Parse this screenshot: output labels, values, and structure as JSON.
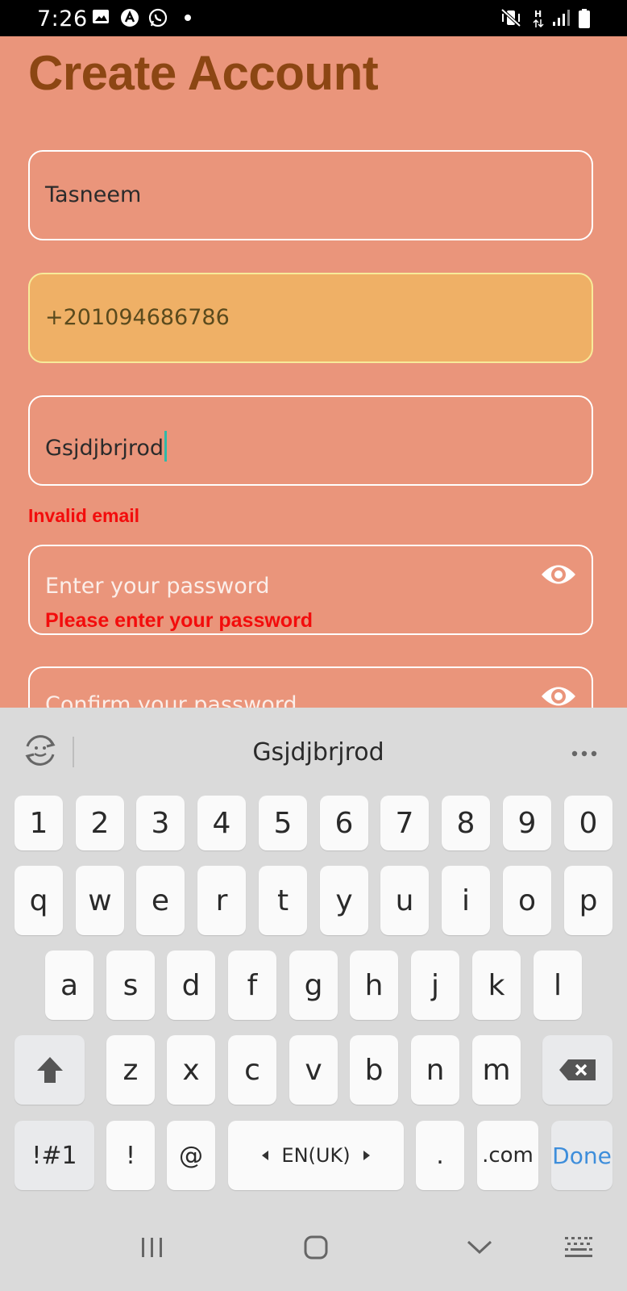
{
  "status_bar": {
    "time": "7:26",
    "icons_left": [
      "gallery-icon",
      "assistant-icon",
      "whatsapp-icon",
      "notification-dot"
    ],
    "icons_right": [
      "vibrate-mute-icon",
      "network-h-icon",
      "signal-icon",
      "battery-icon"
    ]
  },
  "page": {
    "title": "Create Account",
    "title_color": "#8C4613",
    "background": "#EA957B"
  },
  "form": {
    "name_value": "Tasneem",
    "phone_value": "+201094686786",
    "email_value": "Gsjdjbrjrod",
    "email_error": "Invalid email",
    "password_placeholder": "Enter your password",
    "password_error": "Please enter your password",
    "confirm_placeholder": "Confirm your password",
    "error_color": "#F30C0C"
  },
  "keyboard": {
    "suggestion": "Gsjdjbrjrod",
    "rows": [
      [
        "1",
        "2",
        "3",
        "4",
        "5",
        "6",
        "7",
        "8",
        "9",
        "0"
      ],
      [
        "q",
        "w",
        "e",
        "r",
        "t",
        "y",
        "u",
        "i",
        "o",
        "p"
      ],
      [
        "a",
        "s",
        "d",
        "f",
        "g",
        "h",
        "j",
        "k",
        "l"
      ],
      [
        "z",
        "x",
        "c",
        "v",
        "b",
        "n",
        "m"
      ]
    ],
    "symbols_label": "!#1",
    "exclaim_label": "!",
    "at_label": "@",
    "language_label": "EN(UK)",
    "period_label": ".",
    "dotcom_label": ".com",
    "done_label": "Done",
    "done_color": "#3E8EDB"
  }
}
